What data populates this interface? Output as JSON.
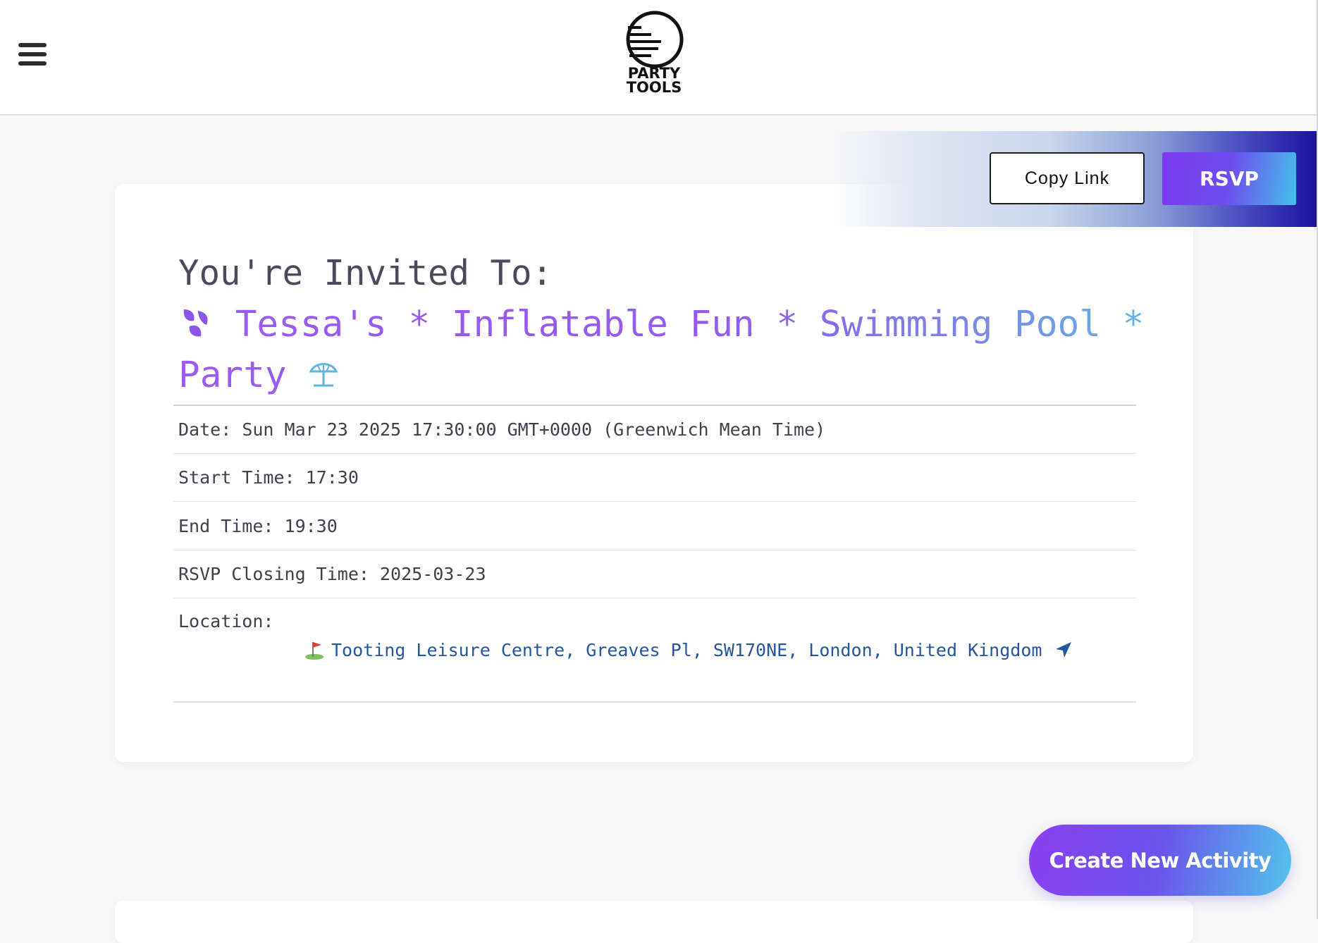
{
  "header": {
    "menu_icon": "hamburger-menu-icon",
    "logo_line1": "PARTY",
    "logo_line2": "TOOLS"
  },
  "actions": {
    "copy_link_label": "Copy Link",
    "rsvp_label": "RSVP"
  },
  "invite": {
    "heading": "You're Invited To:",
    "title_leading_icon": "droplets-icon",
    "title_text": "Tessa's * Inflatable Fun * Swimming Pool * Party",
    "title_trailing_icon": "beach-umbrella-icon"
  },
  "details": {
    "date_label": "Date:",
    "date_value": "Sun Mar 23 2025 17:30:00 GMT+0000 (Greenwich Mean Time)",
    "start_label": "Start Time:",
    "start_value": "17:30",
    "end_label": "End Time:",
    "end_value": "19:30",
    "rsvp_close_label": "RSVP Closing Time:",
    "rsvp_close_value": "2025-03-23",
    "location_label": "Location:",
    "location_value": "Tooting Leisure Centre, Greaves Pl, SW170NE, London, United Kingdom",
    "location_icon": "golf-flag-icon",
    "directions_icon": "navigation-arrow-icon"
  },
  "fab": {
    "label": "Create New Activity"
  },
  "colors": {
    "accent_purple": "#7c3aed",
    "accent_cyan": "#45c1ea",
    "link_blue": "#2456a0",
    "text_dark": "#3f3f4d"
  }
}
